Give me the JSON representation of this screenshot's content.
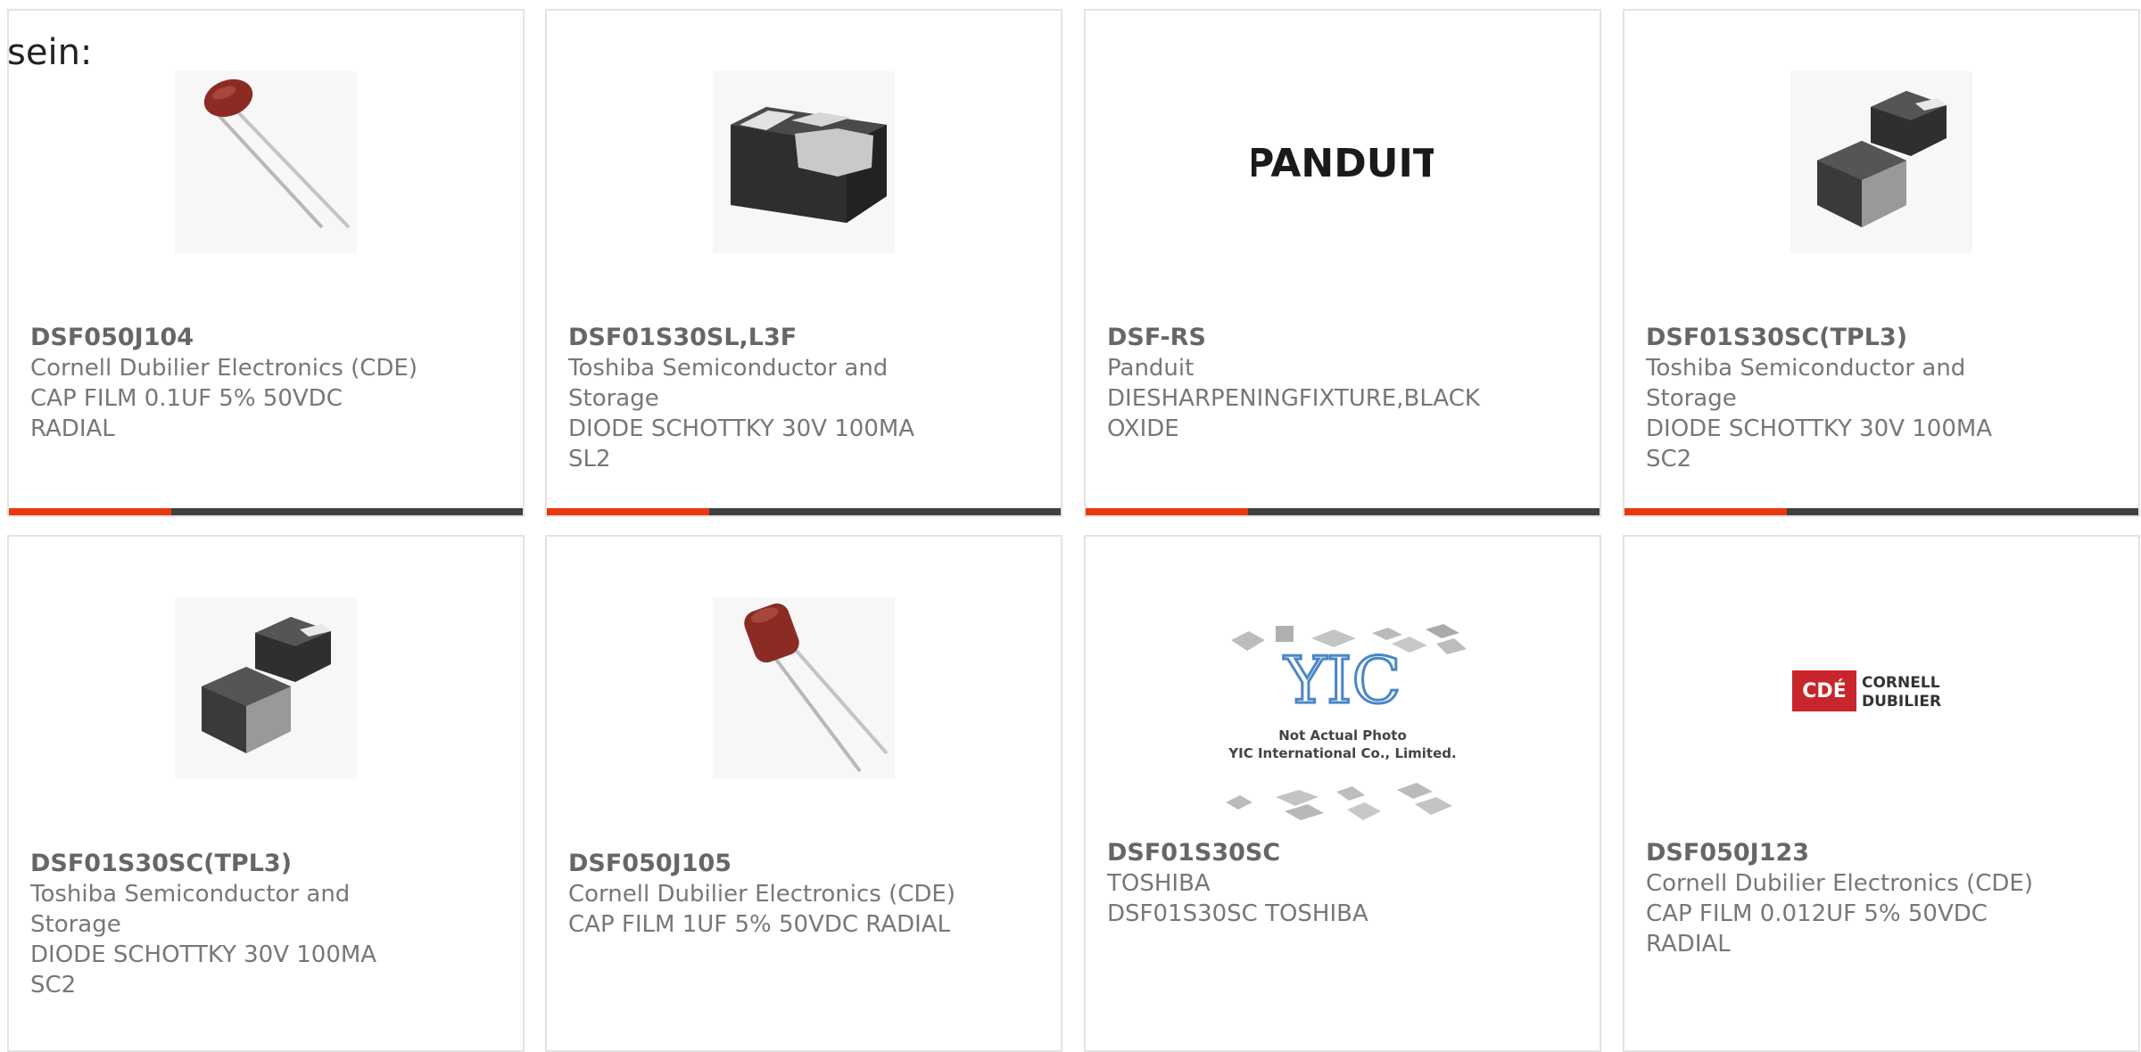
{
  "intro_text": "sein:",
  "colors": {
    "accent": "#e8380d",
    "bar_dark": "#404040",
    "border": "#e3e3e3"
  },
  "products": [
    {
      "part": "DSF050J104",
      "manufacturer": "Cornell Dubilier Electronics (CDE)",
      "description": "CAP FILM 0.1UF 5% 50VDC RADIAL",
      "image": "film-capacitor-image"
    },
    {
      "part": "DSF01S30SL,L3F",
      "manufacturer": "Toshiba Semiconductor and Storage",
      "description": "DIODE SCHOTTKY 30V 100MA SL2",
      "image": "smd-diode-image"
    },
    {
      "part": "DSF-RS",
      "manufacturer": "Panduit",
      "description": "DIESHARPENINGFIXTURE,BLACK OXIDE",
      "image": "panduit-logo",
      "logo_text": "PANDUIT"
    },
    {
      "part": "DSF01S30SC(TPL3)",
      "manufacturer": "Toshiba Semiconductor and Storage",
      "description": "DIODE SCHOTTKY 30V 100MA SC2",
      "image": "smd-diode-pair-image"
    },
    {
      "part": "DSF01S30SC(TPL3)",
      "manufacturer": "Toshiba Semiconductor and Storage",
      "description": "DIODE SCHOTTKY 30V 100MA SC2",
      "image": "smd-diode-pair-image"
    },
    {
      "part": "DSF050J105",
      "manufacturer": "Cornell Dubilier Electronics (CDE)",
      "description": "CAP FILM 1UF 5% 50VDC RADIAL",
      "image": "film-capacitor-image"
    },
    {
      "part": "DSF01S30SC",
      "manufacturer": "TOSHIBA",
      "description": "DSF01S30SC TOSHIBA",
      "image": "yic-placeholder-image",
      "placeholder_line1": "Not Actual Photo",
      "placeholder_line2": "YIC International Co., Limited."
    },
    {
      "part": "DSF050J123",
      "manufacturer": "Cornell Dubilier Electronics (CDE)",
      "description": "CAP FILM 0.012UF 5% 50VDC RADIAL",
      "image": "cde-logo",
      "logo_mark": "CDÉ",
      "logo_line1": "CORNELL",
      "logo_line2": "DUBILIER"
    }
  ]
}
